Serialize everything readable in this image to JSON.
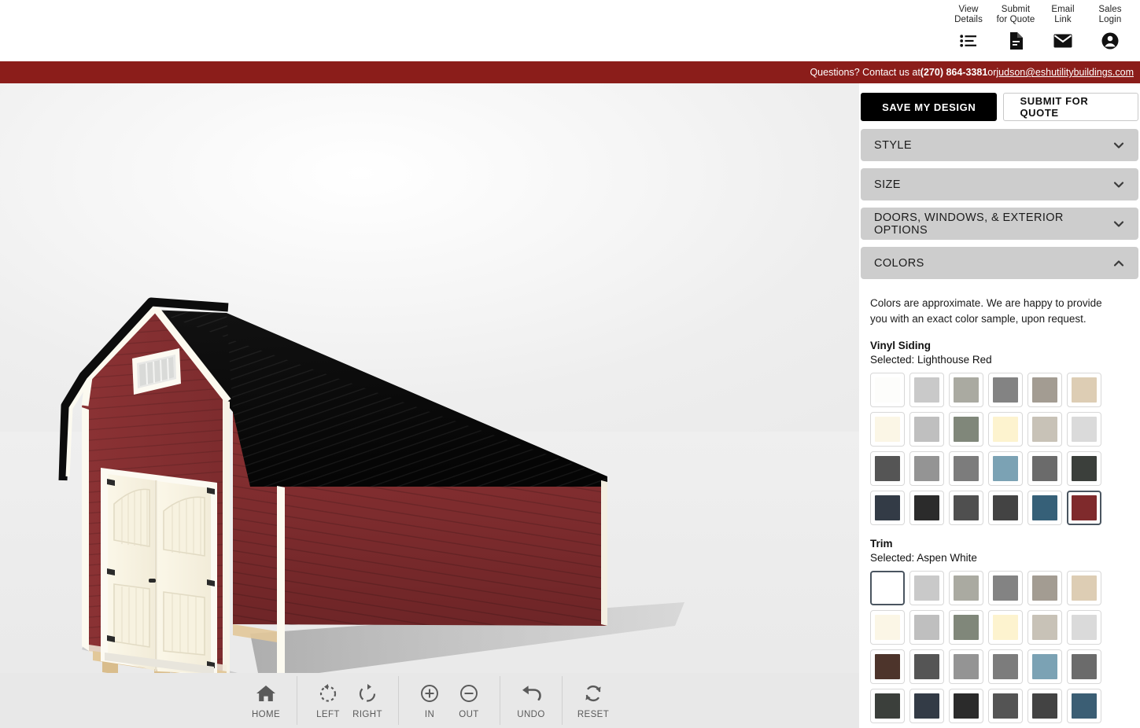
{
  "header": {
    "actions": [
      {
        "label_line1": "View",
        "label_line2": "Details",
        "icon": "list-icon"
      },
      {
        "label_line1": "Submit",
        "label_line2": "for Quote",
        "icon": "document-icon"
      },
      {
        "label_line1": "Email",
        "label_line2": "Link",
        "icon": "envelope-icon"
      },
      {
        "label_line1": "Sales",
        "label_line2": "Login",
        "icon": "account-circle-icon"
      }
    ]
  },
  "contact_bar": {
    "prefix": "Questions? Contact us at ",
    "phone": "(270) 864-3381",
    "separator": " or ",
    "email": "judson@eshutilitybuildings.com",
    "background": "#8b1d1a"
  },
  "panel": {
    "save_label": "SAVE MY DESIGN",
    "submit_label": "SUBMIT FOR QUOTE",
    "sections": [
      {
        "label": "STYLE",
        "expanded": false
      },
      {
        "label": "SIZE",
        "expanded": false
      },
      {
        "label": "DOORS, WINDOWS, & EXTERIOR OPTIONS",
        "expanded": false
      },
      {
        "label": "COLORS",
        "expanded": true
      }
    ],
    "colors": {
      "note": "Colors are approximate. We are happy to provide you with an exact color sample, upon request.",
      "siding": {
        "title": "Vinyl Siding",
        "selected_label": "Selected: Lighthouse Red",
        "selected_index": 23,
        "swatches": [
          "#fdfdfb",
          "#c9c9c9",
          "#aaaaa1",
          "#838383",
          "#a39c92",
          "#ddcdb4",
          "#fbf6e6",
          "#bfbfbf",
          "#80877a",
          "#fdf3cf",
          "#c8c2b7",
          "#dadada",
          "#555555",
          "#949494",
          "#7c7c7c",
          "#7ba2b4",
          "#6b6b6b",
          "#3b3f3b",
          "#333b46",
          "#2b2b2b",
          "#4f4f4f",
          "#434343",
          "#366078",
          "#7f2a2c"
        ]
      },
      "trim": {
        "title": "Trim",
        "selected_label": "Selected: Aspen White",
        "selected_index": 0,
        "swatches": [
          "#ffffff",
          "#c9c9c9",
          "#aaaaa1",
          "#838383",
          "#a39c92",
          "#ddcdb4",
          "#fbf6e6",
          "#bfbfbf",
          "#80877a",
          "#fdf3cf",
          "#c8c2b7",
          "#dadada",
          "#4d342b",
          "#555555",
          "#949494",
          "#7c7c7c",
          "#7ba2b4",
          "#6b6b6b",
          "#3b3f3b",
          "#333b46",
          "#2b2b2b",
          "#545454",
          "#434343",
          "#3b5e74"
        ]
      }
    }
  },
  "toolbar": {
    "groups": [
      {
        "buttons": [
          {
            "label": "HOME",
            "icon": "home-icon"
          }
        ]
      },
      {
        "buttons": [
          {
            "label": "LEFT",
            "icon": "rotate-left-icon"
          },
          {
            "label": "RIGHT",
            "icon": "rotate-right-icon"
          }
        ]
      },
      {
        "buttons": [
          {
            "label": "IN",
            "icon": "zoom-in-icon"
          },
          {
            "label": "OUT",
            "icon": "zoom-out-icon"
          }
        ]
      },
      {
        "buttons": [
          {
            "label": "UNDO",
            "icon": "undo-icon"
          }
        ]
      },
      {
        "buttons": [
          {
            "label": "RESET",
            "icon": "reset-icon"
          }
        ]
      }
    ]
  },
  "model": {
    "siding_color": "#7f2a2c",
    "roof_color": "#0d0d0d",
    "trim_color": "#fdfbf2",
    "skid_color": "#e2c89a",
    "shadow_color": "#a8a8a8"
  }
}
